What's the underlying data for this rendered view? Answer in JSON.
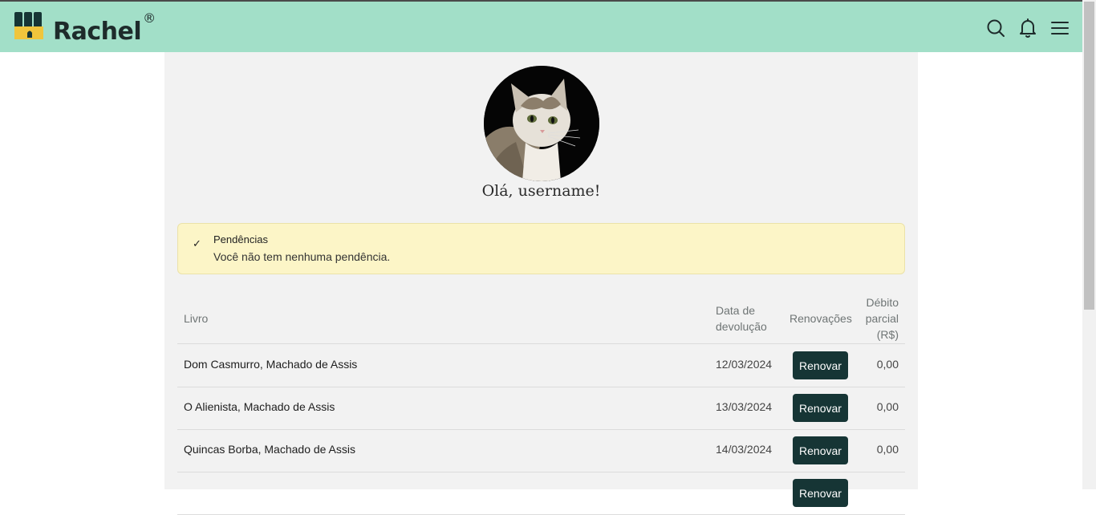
{
  "header": {
    "brand": "Rachel",
    "registered": "®",
    "icons": [
      "search-icon",
      "bell-icon",
      "menu-icon"
    ],
    "background": "#a2dfc8"
  },
  "profile": {
    "greeting": "Olá, username!"
  },
  "alert": {
    "check": "✓",
    "title": "Pendências",
    "message": "Você não tem nenhuma pendência."
  },
  "table": {
    "headers": {
      "book": "Livro",
      "date_l1": "Data de",
      "date_l2": "devolução",
      "renewals": "Renovações",
      "debt_l1": "Débito",
      "debt_l2": "parcial",
      "debt_l3": "(R$)"
    },
    "rows": [
      {
        "book": "Dom Casmurro, Machado de Assis",
        "date": "12/03/2024",
        "action": "Renovar",
        "debt": "0,00"
      },
      {
        "book": "O Alienista, Machado de Assis",
        "date": "13/03/2024",
        "action": "Renovar",
        "debt": "0,00"
      },
      {
        "book": "Quincas Borba, Machado de Assis",
        "date": "14/03/2024",
        "action": "Renovar",
        "debt": "0,00"
      },
      {
        "book": "",
        "date": "",
        "action": "Renovar",
        "debt": ""
      }
    ]
  },
  "colors": {
    "accent": "#163535",
    "alert_bg": "#fcf5c7",
    "content_bg": "#f2f2f2"
  }
}
